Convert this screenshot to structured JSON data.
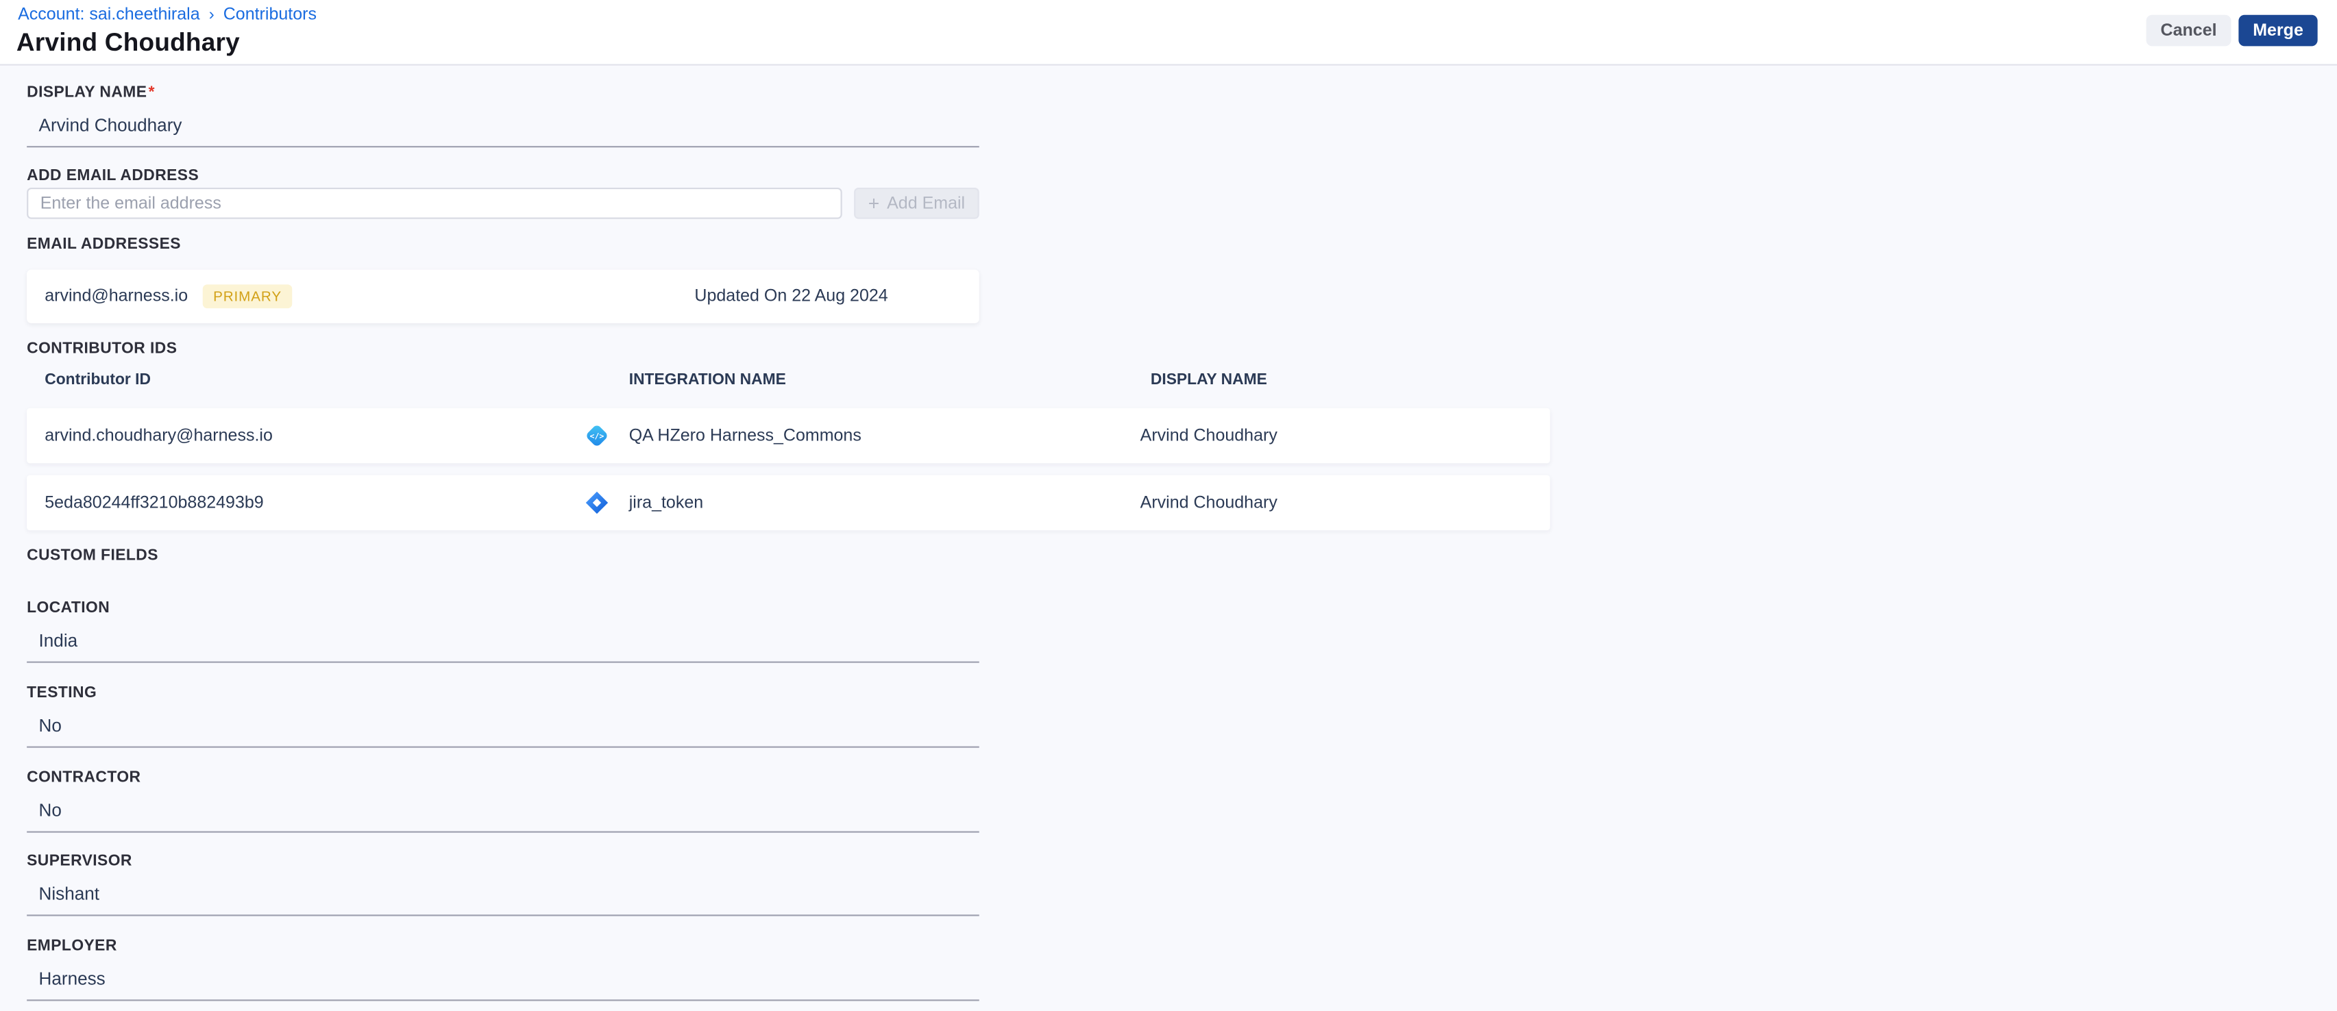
{
  "breadcrumb": {
    "account_link": "Account: sai.cheethirala",
    "separator": "›",
    "current": "Contributors"
  },
  "header": {
    "title": "Arvind Choudhary",
    "cancel_label": "Cancel",
    "merge_label": "Merge"
  },
  "display_name_field": {
    "label": "DISPLAY NAME",
    "required_mark": "*",
    "value": "Arvind Choudhary"
  },
  "add_email": {
    "label": "ADD EMAIL ADDRESS",
    "placeholder": "Enter the email address",
    "plus_glyph": "+",
    "button_label": "Add Email"
  },
  "email_addresses": {
    "label": "EMAIL ADDRESSES",
    "items": [
      {
        "email": "arvind@harness.io",
        "badge": "PRIMARY",
        "updated": "Updated On 22 Aug 2024"
      }
    ]
  },
  "contributor_ids": {
    "label": "CONTRIBUTOR IDS",
    "columns": {
      "id": "Contributor ID",
      "integration": "INTEGRATION NAME",
      "display_name": "DISPLAY NAME"
    },
    "rows": [
      {
        "id": "arvind.choudhary@harness.io",
        "integration_icon": "code-integration-icon",
        "integration": "QA HZero Harness_Commons",
        "display_name": "Arvind Choudhary"
      },
      {
        "id": "5eda80244ff3210b882493b9",
        "integration_icon": "jira-icon",
        "integration": "jira_token",
        "display_name": "Arvind Choudhary"
      }
    ]
  },
  "custom_fields": {
    "label": "CUSTOM FIELDS",
    "fields": [
      {
        "label": "LOCATION",
        "value": "India"
      },
      {
        "label": "TESTING",
        "value": "No"
      },
      {
        "label": "CONTRACTOR",
        "value": "No"
      },
      {
        "label": "SUPERVISOR",
        "value": "Nishant"
      },
      {
        "label": "EMPLOYER",
        "value": "Harness"
      }
    ]
  },
  "colors": {
    "page_background": "#f8f9fd",
    "link_blue": "#1a6ce0",
    "merge_button_blue": "#1b4793",
    "primary_badge_bg": "#fcf4d5",
    "primary_badge_text": "#d2a117",
    "value_navy": "#2b3a55",
    "required_red": "#e3382b"
  }
}
